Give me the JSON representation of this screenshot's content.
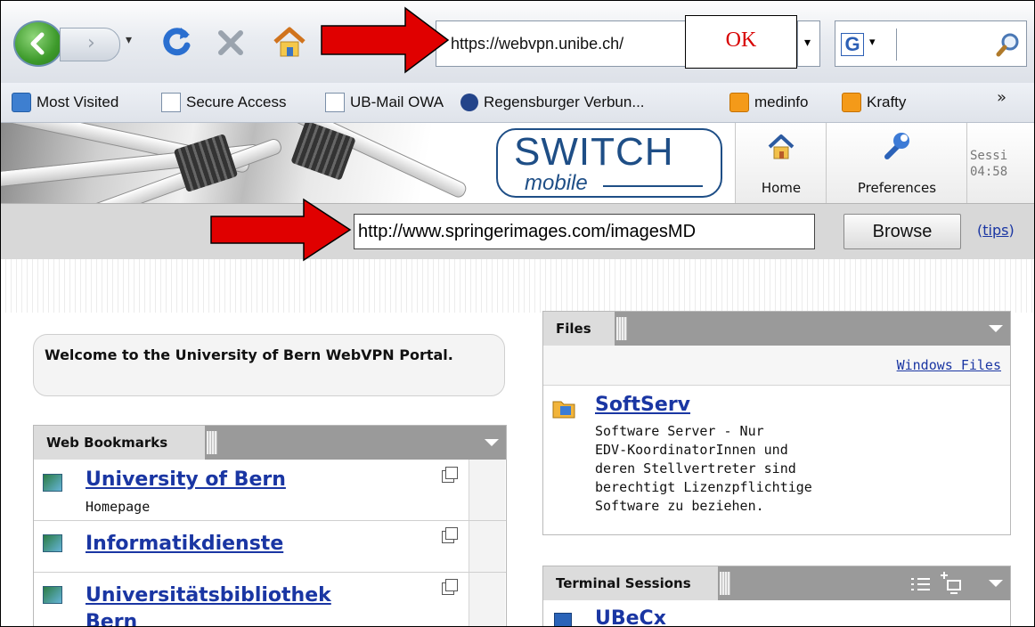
{
  "browser": {
    "url": "https://webvpn.unibe.ch/",
    "ok_label": "OK"
  },
  "bookmarks_bar": {
    "items": [
      {
        "label": "Most Visited",
        "icon": "search-folder-icon"
      },
      {
        "label": "Secure Access",
        "icon": "page-icon"
      },
      {
        "label": "UB-Mail OWA",
        "icon": "page-icon"
      },
      {
        "label": "Regensburger Verbun...",
        "icon": "ur-icon"
      },
      {
        "label": "medinfo",
        "icon": "rss-icon"
      },
      {
        "label": "Krafty",
        "icon": "rss-icon"
      }
    ],
    "more": "»"
  },
  "portal": {
    "logo_main": "SWITCH",
    "logo_sub": "mobile",
    "nav": {
      "home": "Home",
      "preferences": "Preferences",
      "session_line1": "Sessi",
      "session_line2": "04:58"
    },
    "address_value": "http://www.springerimages.com/imagesMD",
    "browse_label": "Browse",
    "tips_open": "(",
    "tips_label": "tips",
    "tips_close": ")"
  },
  "welcome": "Welcome to the University of Bern WebVPN Portal.",
  "web_bookmarks": {
    "title": "Web Bookmarks",
    "items": [
      {
        "label": "University of Bern",
        "sub": "Homepage"
      },
      {
        "label": "Informatikdienste",
        "sub": ""
      },
      {
        "label": "Universitätsbibliothek",
        "label2": "Bern"
      }
    ]
  },
  "files": {
    "title": "Files",
    "windows_files": "Windows Files",
    "item_title": "SoftServ",
    "item_desc": [
      "Software Server - Nur",
      "EDV-KoordinatorInnen und",
      "deren Stellvertreter sind",
      "berechtigt Lizenzpflichtige",
      "Software zu beziehen."
    ]
  },
  "terminal": {
    "title": "Terminal Sessions",
    "item": "UBeCx"
  },
  "colors": {
    "arrow": "#e00000",
    "link": "#1a36a3",
    "logo": "#1e4e86"
  }
}
